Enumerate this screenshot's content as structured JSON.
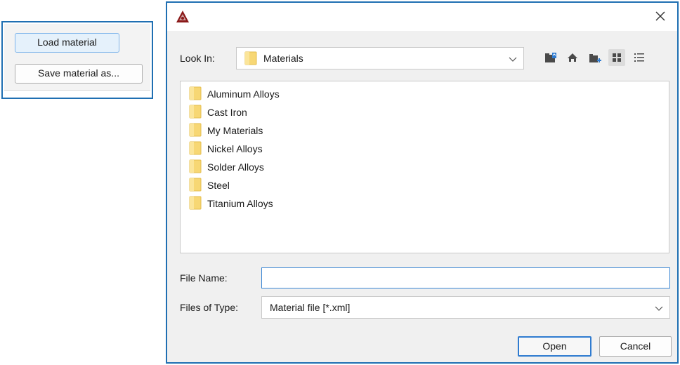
{
  "left_panel": {
    "load_label": "Load material",
    "save_label": "Save material as..."
  },
  "dialog": {
    "title": "",
    "app_icon": "app-logo-icon",
    "close_icon": "close-icon",
    "look_in_label": "Look In:",
    "look_in_value": "Materials",
    "toolbar_icons": [
      "up-folder-icon",
      "home-icon",
      "new-folder-icon",
      "list-view-icon",
      "details-view-icon"
    ],
    "folders": [
      "Aluminum Alloys",
      "Cast Iron",
      "My Materials",
      "Nickel Alloys",
      "Solder Alloys",
      "Steel",
      "Titanium Alloys"
    ],
    "file_name_label": "File Name:",
    "file_name_value": "",
    "files_of_type_label": "Files of Type:",
    "files_of_type_value": "Material file [*.xml]",
    "open_label": "Open",
    "cancel_label": "Cancel"
  },
  "colors": {
    "accent_border": "#1f6fb2",
    "folder_yellow": "#f7d774",
    "app_icon_red": "#8b1a1a"
  }
}
